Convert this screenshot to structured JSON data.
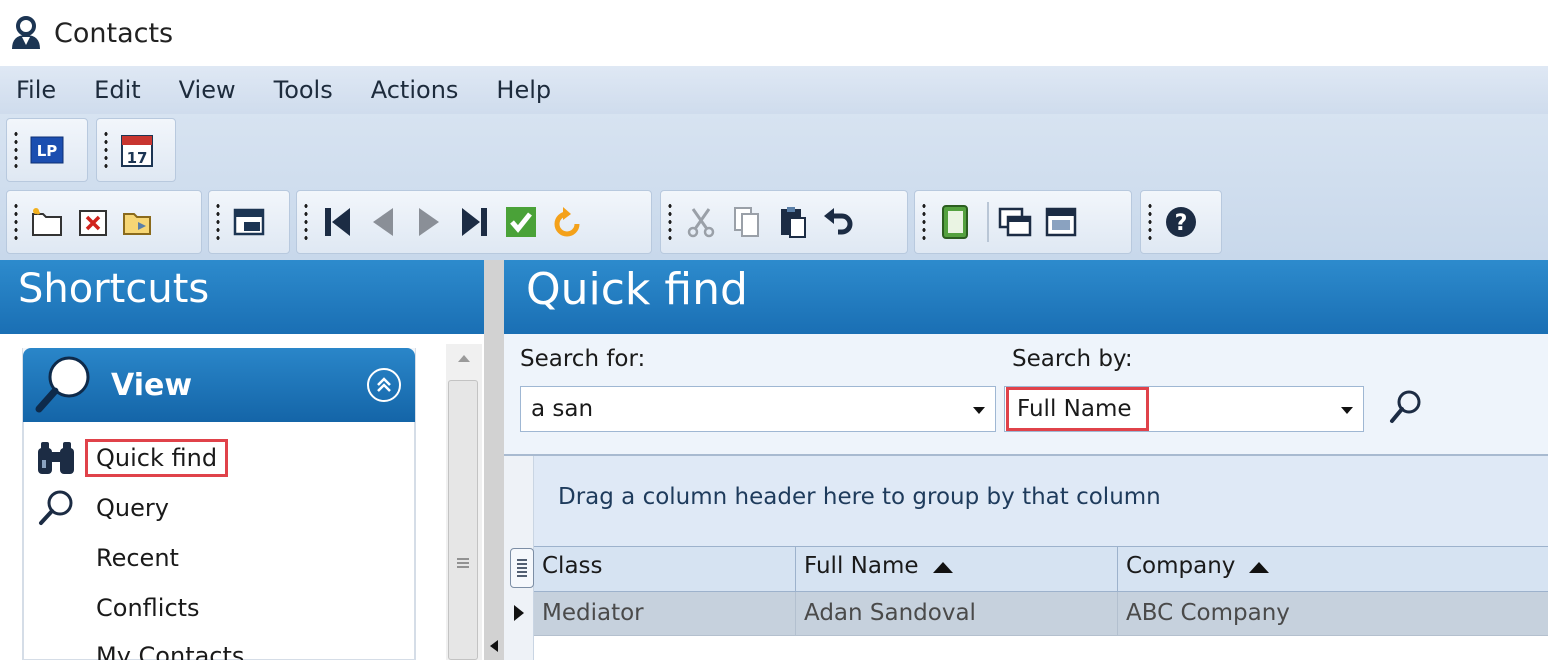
{
  "window": {
    "title": "Contacts",
    "icon": "contacts-person-icon"
  },
  "menu": [
    "File",
    "Edit",
    "View",
    "Tools",
    "Actions",
    "Help"
  ],
  "toolbar": {
    "top": [
      {
        "name": "lp-button",
        "icon": "lp-icon",
        "text": "LP"
      },
      {
        "name": "calendar-button",
        "icon": "calendar-icon",
        "text": "17"
      }
    ],
    "bottom_icons": [
      "new-folder-icon",
      "delete-icon",
      "open-folder-icon",
      "print-preview-icon",
      "first-record-icon",
      "previous-record-icon",
      "next-record-icon",
      "last-record-icon",
      "save-check-icon",
      "refresh-icon",
      "cut-icon",
      "copy-icon",
      "paste-icon",
      "undo-icon",
      "notes-icon",
      "card-view-icon",
      "window-icon",
      "help-icon"
    ]
  },
  "shortcuts": {
    "title": "Shortcuts",
    "view_card": {
      "title": "View",
      "items": [
        {
          "label": "Quick find",
          "icon": "binoculars-icon"
        },
        {
          "label": "Query",
          "icon": "magnifier-icon"
        },
        {
          "label": "Recent",
          "icon": ""
        },
        {
          "label": "Conflicts",
          "icon": ""
        },
        {
          "label": "My Contacts",
          "icon": ""
        }
      ]
    }
  },
  "quick_find": {
    "title": "Quick find",
    "search_for_label": "Search for:",
    "search_for_value": "a san",
    "search_by_label": "Search by:",
    "search_by_value": "Full Name"
  },
  "grid": {
    "group_hint": "Drag a column header here to group by that column",
    "columns": [
      {
        "label": "Class",
        "sorted": false
      },
      {
        "label": "Full Name",
        "sorted": "asc"
      },
      {
        "label": "Company",
        "sorted": "asc"
      }
    ],
    "rows": [
      [
        "Mediator",
        "Adan Sandoval",
        "ABC Company"
      ]
    ]
  },
  "colors": {
    "header_blue": "#1f78bf",
    "highlight_red": "#e0424a",
    "menu_bg": "#d7e3f1"
  }
}
